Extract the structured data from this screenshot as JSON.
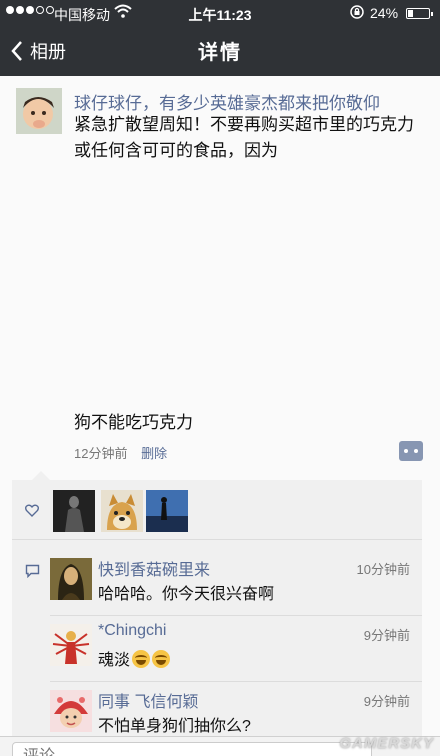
{
  "status_bar": {
    "carrier": "中国移动",
    "time": "上午11:23",
    "battery_percent_label": "24%",
    "battery_level": 0.24
  },
  "nav": {
    "back_label": "相册",
    "title": "详情"
  },
  "post": {
    "author": "球仔球仔，有多少英雄豪杰都来把你敬仰",
    "text": "紧急扩散望周知！不要再购买超市里的巧克力或任何含可可的食品，因为",
    "extra_text": "狗不能吃巧克力",
    "time": "12分钟前",
    "delete_label": "删除"
  },
  "likes": {
    "avatars": [
      "like-avatar-1",
      "like-avatar-2",
      "like-avatar-3"
    ]
  },
  "comments": [
    {
      "name": "快到香菇碗里来",
      "time": "10分钟前",
      "text": "哈哈哈。你今天很兴奋啊"
    },
    {
      "name": "*Chingchi",
      "time": "9分钟前",
      "text": "魂淡"
    },
    {
      "name": "同事 飞信何颖",
      "time": "9分钟前",
      "text": "不怕单身狗们抽你么?"
    }
  ],
  "comment_input": {
    "placeholder": "评论"
  },
  "watermark": "GAMERSKY",
  "colors": {
    "nav_bg": "#2f3236",
    "link": "#576b95",
    "panel_bg": "#f0f0f0"
  }
}
